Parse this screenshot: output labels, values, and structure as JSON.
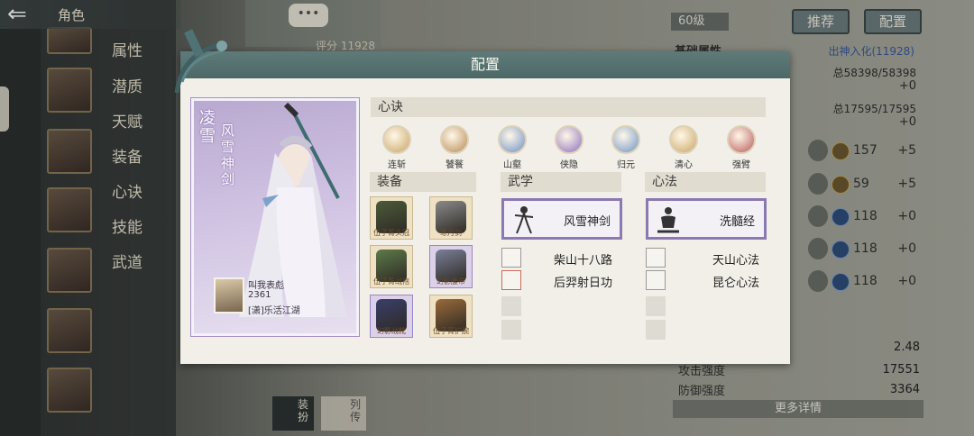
{
  "back": {
    "title": "角色"
  },
  "sidebar": {
    "menu": [
      "属性",
      "潜质",
      "天赋",
      "装备",
      "心诀",
      "技能",
      "武道"
    ]
  },
  "top": {
    "chat": "•••",
    "score_label": "评分 11928",
    "level": "60级",
    "recommend_btn": "推荐",
    "config_btn": "配置"
  },
  "right_panel": {
    "basic_attr": "基础属性",
    "realm": "出神入化(11928)",
    "hp": "总58398/58398",
    "hp_plus": "+0",
    "mp": "总17595/17595",
    "mp_plus": "+0",
    "stats": [
      {
        "num": "157",
        "plus": "+5"
      },
      {
        "num": "59",
        "plus": "+5"
      },
      {
        "num": "118",
        "plus": "+0"
      },
      {
        "num": "118",
        "plus": "+0"
      },
      {
        "num": "118",
        "plus": "+0"
      }
    ],
    "bottom_first_value": "2.48",
    "attack_label": "攻击强度",
    "attack_value": "17551",
    "defense_label": "防御强度",
    "defense_value": "3364",
    "more_details": "更多详情"
  },
  "bottom_tabs": {
    "equip": "装扮",
    "bio": "列传"
  },
  "modal": {
    "title": "配置",
    "character": {
      "name": "凌雪",
      "weapon": "风雪神剑",
      "player_name": "叫我表彪",
      "player_score": "2361",
      "player_guild": "[潇]乐活江湖"
    },
    "xinjue_header": "心诀",
    "xinjue": [
      {
        "label": "连斩",
        "color": "#c9a465"
      },
      {
        "label": "饕餮",
        "color": "#b88a56"
      },
      {
        "label": "山壑",
        "color": "#6f8fc4"
      },
      {
        "label": "侠隐",
        "color": "#8d6fbe"
      },
      {
        "label": "归元",
        "color": "#6f93c7"
      },
      {
        "label": "清心",
        "color": "#c9a465"
      },
      {
        "label": "强臂",
        "color": "#b85a5a"
      }
    ],
    "equip_header": "装备",
    "equipment": [
      {
        "caption": "伍子胥头冠",
        "icon": "helmet-icon",
        "rarity": "gold"
      },
      {
        "caption": "寒月剑",
        "icon": "sword-icon",
        "rarity": "gold"
      },
      {
        "caption": "伍子胥战袍",
        "icon": "armor-icon",
        "rarity": "gold"
      },
      {
        "caption": "幻影腰带",
        "icon": "belt-icon",
        "rarity": "purple"
      },
      {
        "caption": "幻影战靴",
        "icon": "boots-icon",
        "rarity": "purple"
      },
      {
        "caption": "伍子胥护腕",
        "icon": "bracer-icon",
        "rarity": "gold"
      }
    ],
    "wuxue_header": "武学",
    "wuxue_main": "风雪神剑",
    "wuxue_list": [
      "柴山十八路",
      "后羿射日功"
    ],
    "xinfa_header": "心法",
    "xinfa_main": "洗髓经",
    "xinfa_list": [
      "天山心法",
      "昆仑心法"
    ]
  }
}
